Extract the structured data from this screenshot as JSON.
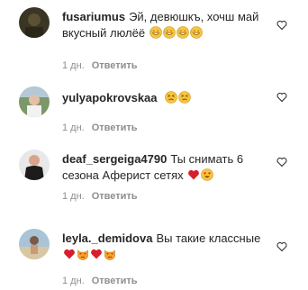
{
  "comments": [
    {
      "username": "fusariumus",
      "text": "Эй, девюшкъ, хочш май вкусный люлёё",
      "emojis": [
        "grinning-sweat",
        "grinning-sweat",
        "grinning-sweat",
        "grinning-sweat"
      ],
      "time": "1 дн.",
      "reply_label": "Ответить",
      "avatar": "dark-olive-avatar"
    },
    {
      "username": "yulyapokrovskaa",
      "text": "",
      "emojis": [
        "tired-face",
        "tired-face"
      ],
      "time": "1 дн.",
      "reply_label": "Ответить",
      "avatar": "outdoor-person-avatar"
    },
    {
      "username": "deaf_sergeiga4790",
      "text": "Ты снимать 6 сезона Аферист сетях",
      "emojis": [
        "red-heart",
        "heart-eyes"
      ],
      "time": "1 дн.",
      "reply_label": "Ответить",
      "avatar": "dark-shirt-avatar"
    },
    {
      "username": "leyla._demidova",
      "text": "Вы такие классные",
      "emojis": [
        "red-heart",
        "heart-eyes-cat",
        "red-heart",
        "heart-eyes-cat"
      ],
      "time": "1 дн.",
      "reply_label": "Ответить",
      "avatar": "beach-avatar"
    }
  ],
  "colors": {
    "text": "#262626",
    "meta": "#8e8e8e",
    "heart": "#ed4956",
    "emoji_yellow": "#f7c43c"
  }
}
